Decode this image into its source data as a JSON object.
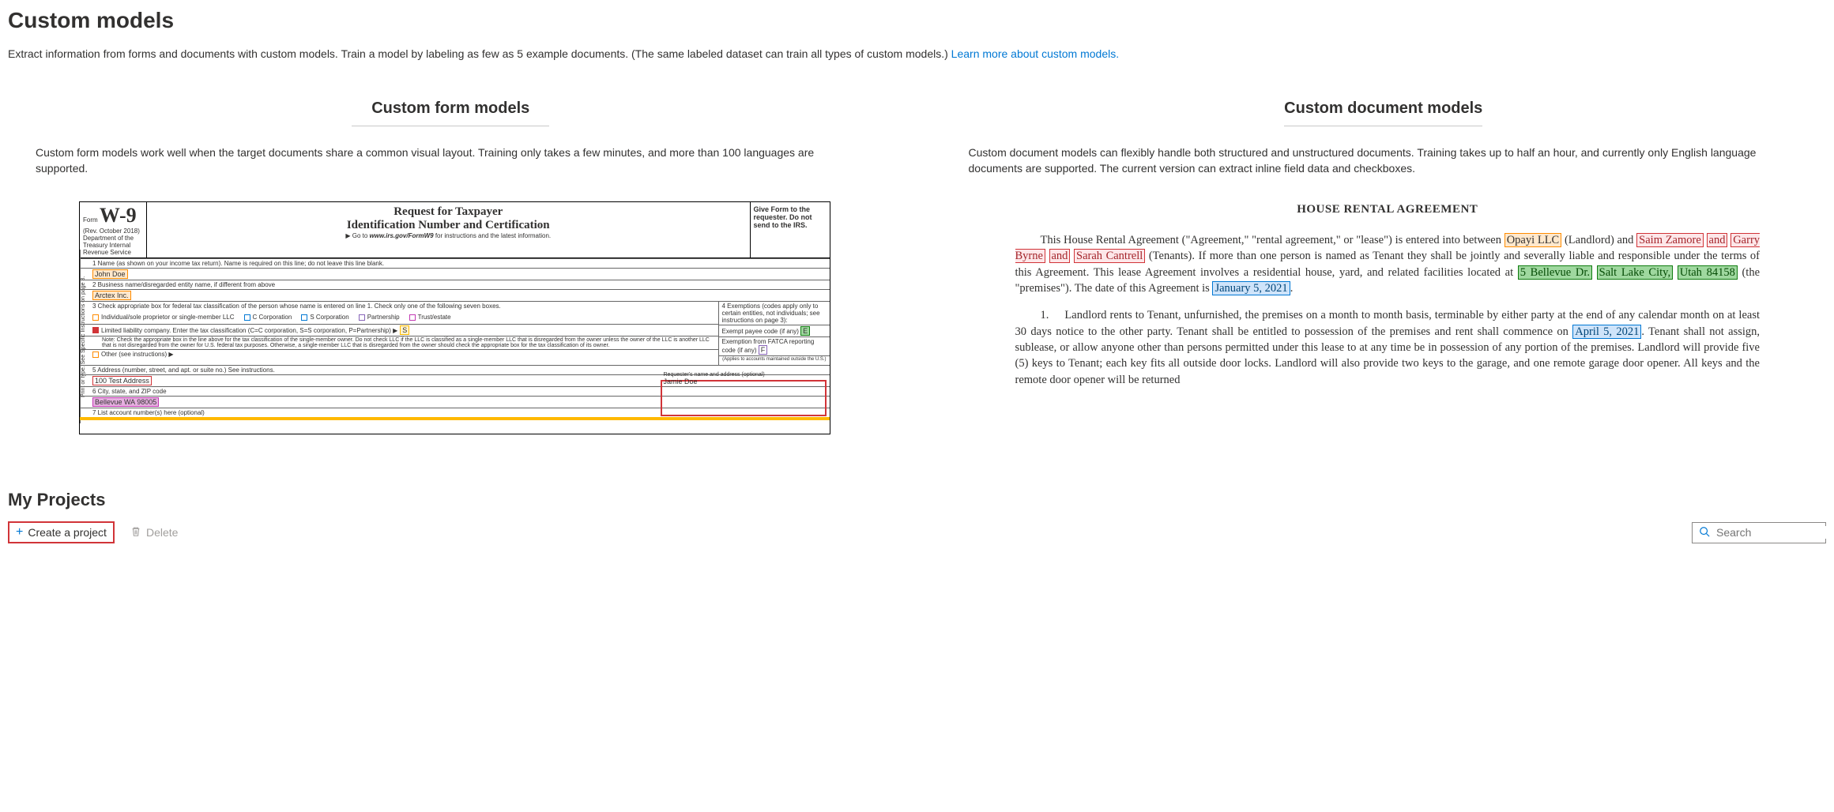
{
  "header": {
    "title": "Custom models",
    "intro_prefix": "Extract information from forms and documents with custom models. Train a model by labeling as few as 5 example documents. (The same labeled dataset can train all types of custom models.) ",
    "intro_link": "Learn more about custom models."
  },
  "form_models": {
    "heading": "Custom form models",
    "description": "Custom form models work well when the target documents share a common visual layout. Training only takes a few minutes, and more than 100 languages are supported.",
    "w9": {
      "form_label": "Form",
      "form_code": "W-9",
      "rev": "(Rev. October 2018)",
      "dept": "Department of the Treasury Internal Revenue Service",
      "title_line1": "Request for Taxpayer",
      "title_line2": "Identification Number and Certification",
      "goto_prefix": "▶ Go to ",
      "goto_url": "www.irs.gov/FormW9",
      "goto_suffix": " for instructions and the latest information.",
      "give_form": "Give Form to the requester. Do not send to the IRS.",
      "side_label": "Print or type. See Specific Instructions on page 3.",
      "line1_label": "1  Name (as shown on your income tax return). Name is required on this line; do not leave this line blank.",
      "line1_value": "John Doe",
      "line2_label": "2  Business name/disregarded entity name, if different from above",
      "line2_value": "Arctex Inc.",
      "line3_label": "3  Check appropriate box for federal tax classification of the person whose name is entered on line 1. Check only one of the following seven boxes.",
      "checks": {
        "individual": "Individual/sole proprietor or single-member LLC",
        "ccorp": "C Corporation",
        "scorp": "S Corporation",
        "partnership": "Partnership",
        "trust": "Trust/estate",
        "llc": "Limited liability company. Enter the tax classification (C=C corporation, S=S corporation, P=Partnership) ▶",
        "llc_value": "S",
        "other": "Other (see instructions) ▶"
      },
      "llc_note": "Note: Check the appropriate box in the line above for the tax classification of the single-member owner. Do not check LLC if the LLC is classified as a single-member LLC that is disregarded from the owner unless the owner of the LLC is another LLC that is not disregarded from the owner for U.S. federal tax purposes. Otherwise, a single-member LLC that is disregarded from the owner should check the appropriate box for the tax classification of its owner.",
      "line4_label": "4  Exemptions (codes apply only to certain entities, not individuals; see instructions on page 3):",
      "exempt_payee": "Exempt payee code (if any)",
      "exempt_payee_value": "E",
      "fatca": "Exemption from FATCA reporting code (if any)",
      "fatca_value": "F",
      "fatca_note": "(Applies to accounts maintained outside the U.S.)",
      "line5_label": "5  Address (number, street, and apt. or suite no.) See instructions.",
      "line5_value": "100 Test Address",
      "line6_label": "6  City, state, and ZIP code",
      "line6_value": "Bellevue WA 98005",
      "line7_label": "7  List account number(s) here (optional)",
      "requester_label": "Requester's name and address (optional)",
      "requester_value": "Jamie Doe"
    }
  },
  "document_models": {
    "heading": "Custom document models",
    "description": "Custom document models can flexibly handle both structured and unstructured documents. Training takes up to half an hour, and currently only English language documents are supported. The current version can extract inline field data and checkboxes.",
    "house": {
      "title": "HOUSE RENTAL AGREEMENT",
      "p1_a": "This House Rental Agreement (\"Agreement,\" \"rental agreement,\" or \"lease\") is entered into between ",
      "landlord": "Opayi LLC",
      "p1_b": " (Landlord) and ",
      "tenant1": "Saim Zamore",
      "and1": "and",
      "tenant2": "Garry Byrne",
      "and2": "and",
      "tenant3": "Sarah Cantrell",
      "p1_c": " (Tenants). If more than one person is named as Tenant they shall be jointly and severally liable and responsible under the terms of this Agreement. This lease Agreement involves a residential house, yard, and related facilities located at ",
      "addr1": "5 Bellevue Dr.",
      "addr2": "Salt Lake City,",
      "addr3": "Utah 84158",
      "p1_d": " (the \"premises\"). The date of this Agreement is ",
      "date1": "January 5, 2021",
      "p1_e": ".",
      "p2_num": "1.",
      "p2_a": "Landlord rents to Tenant, unfurnished, the premises on a month to month basis, terminable by either party at the end of any calendar month on at least 30 days notice to the other party. Tenant shall be entitled to possession of the premises and rent shall commence on ",
      "date2": "April 5, 2021",
      "p2_b": ". Tenant shall not assign, sublease, or allow anyone other than persons permitted under this lease to at any time be in possession of any portion of the premises. Landlord will provide five (5) keys to Tenant; each key fits all outside door locks. Landlord will also provide two keys to the garage, and one remote garage door opener. All keys and the remote door opener will be returned"
    }
  },
  "projects": {
    "heading": "My Projects",
    "create_label": "Create a project",
    "delete_label": "Delete",
    "search_placeholder": "Search"
  }
}
